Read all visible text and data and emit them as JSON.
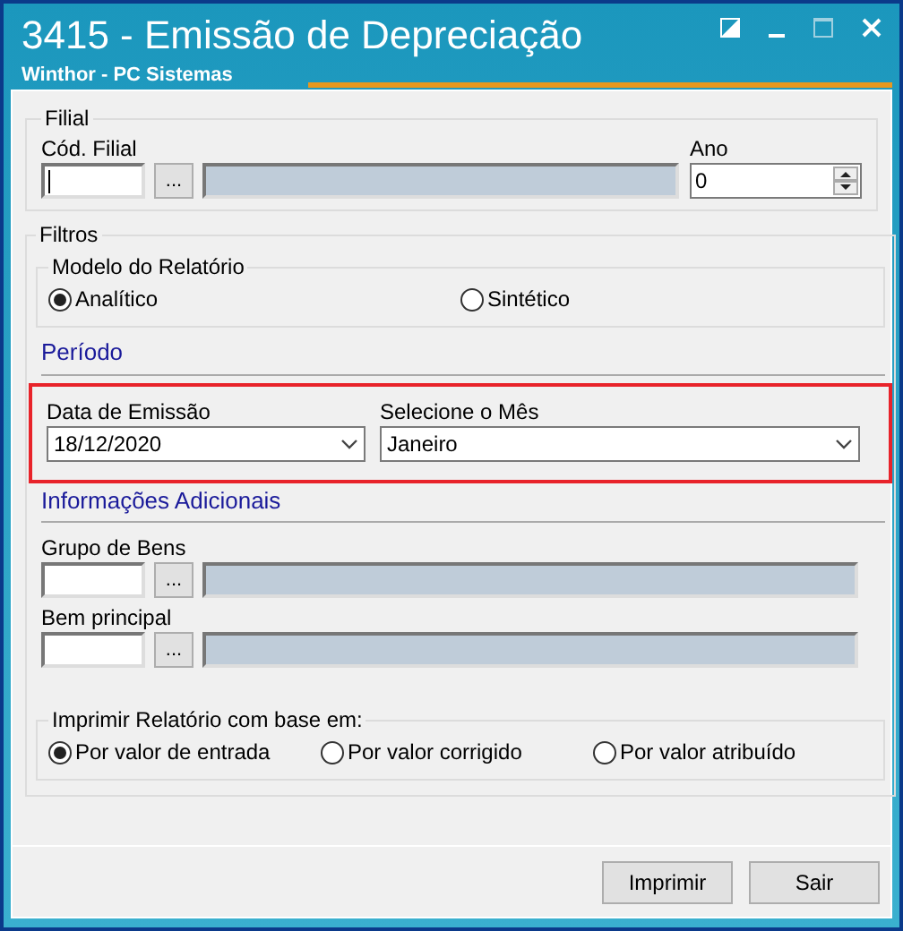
{
  "window": {
    "title": "3415 - Emissão de Depreciação",
    "subtitle": "Winthor - PC Sistemas"
  },
  "filial": {
    "legend": "Filial",
    "cod_label": "Cód. Filial",
    "lookup_button": "...",
    "ano_label": "Ano",
    "ano_value": "0"
  },
  "filtros": {
    "legend": "Filtros",
    "modelo": {
      "legend": "Modelo do Relatório",
      "options": [
        {
          "label": "Analítico",
          "selected": true
        },
        {
          "label": "Sintético",
          "selected": false
        }
      ]
    },
    "periodo": {
      "heading": "Período",
      "highlighted": true,
      "fields": [
        {
          "label": "Data de Emissão",
          "value": "18/12/2020"
        },
        {
          "label": "Selecione o Mês",
          "value": "Janeiro"
        }
      ]
    },
    "adicionais": {
      "heading": "Informações Adicionais",
      "lookups": [
        {
          "label": "Grupo de Bens",
          "button": "..."
        },
        {
          "label": "Bem principal",
          "button": "..."
        }
      ]
    },
    "base": {
      "legend": "Imprimir Relatório com base em:",
      "options": [
        {
          "label": "Por valor de entrada",
          "selected": true
        },
        {
          "label": "Por valor corrigido",
          "selected": false
        },
        {
          "label": "Por valor atribuído",
          "selected": false
        }
      ]
    }
  },
  "buttons": [
    "Imprimir",
    "Sair"
  ]
}
